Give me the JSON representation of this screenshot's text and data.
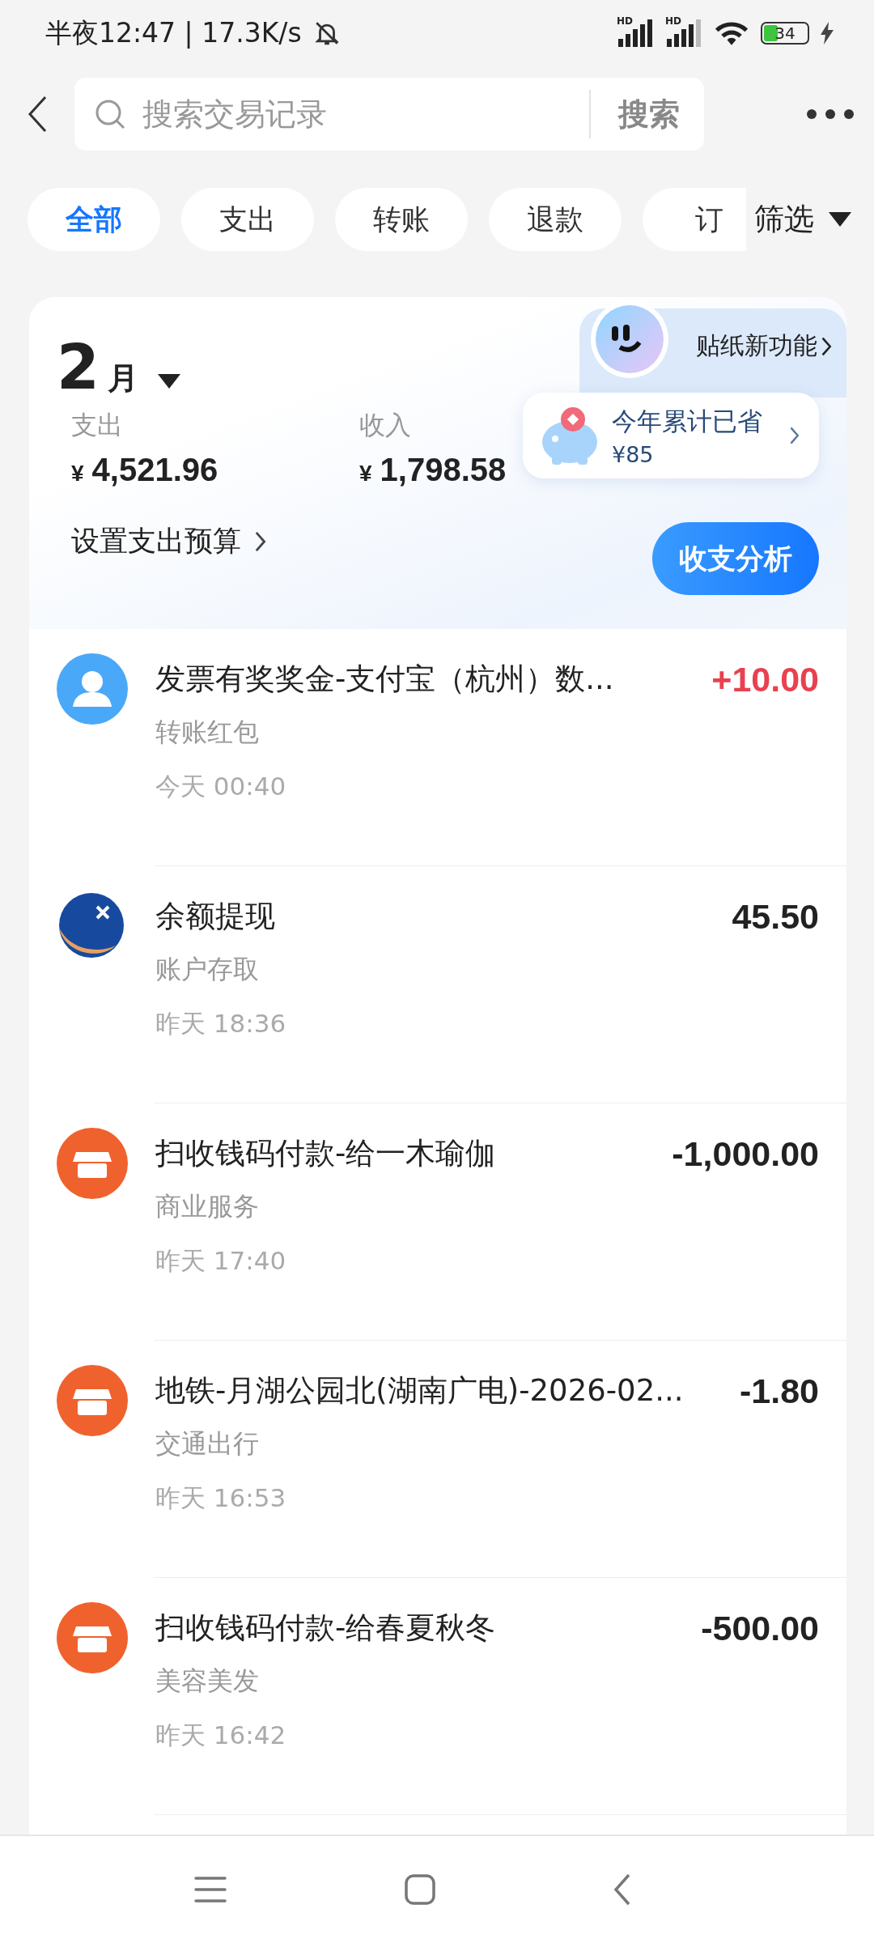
{
  "status_bar": {
    "time": "半夜12:47 | 17.3K/s",
    "signals": [
      {
        "label": "HD"
      },
      {
        "label": "HD"
      }
    ],
    "battery": "34"
  },
  "search": {
    "placeholder": "搜索交易记录",
    "button": "搜索"
  },
  "tabs": [
    {
      "label": "全部",
      "selected": true
    },
    {
      "label": "支出",
      "selected": false
    },
    {
      "label": "转账",
      "selected": false
    },
    {
      "label": "退款",
      "selected": false
    },
    {
      "label": "订",
      "selected": false
    }
  ],
  "filter": "筛选",
  "summary": {
    "month": "2",
    "month_unit": "月",
    "sticker": "贴纸新功能",
    "expense_label": "支出",
    "expense": "4,521.96",
    "income_label": "收入",
    "income": "1,798.58",
    "currency": "¥",
    "savings_label": "今年累计已省",
    "savings": "¥85",
    "budget_link": "设置支出预算",
    "analysis_button": "收支分析"
  },
  "transactions": [
    {
      "kind": "person",
      "title": "发票有奖奖金-支付宝（杭州）数...",
      "category": "转账红包",
      "time": "今天 00:40",
      "amount": "+10.00",
      "income": true
    },
    {
      "kind": "logo",
      "title": "余额提现",
      "category": "账户存取",
      "time": "昨天 18:36",
      "amount": "45.50",
      "income": false
    },
    {
      "kind": "shop",
      "title": "扫收钱码付款-给一木瑜伽",
      "category": "商业服务",
      "time": "昨天 17:40",
      "amount": "-1,000.00",
      "income": false
    },
    {
      "kind": "shop",
      "title": "地铁-月湖公园北(湖南广电)-2026-02...",
      "category": "交通出行",
      "time": "昨天 16:53",
      "amount": "-1.80",
      "income": false
    },
    {
      "kind": "shop",
      "title": "扫收钱码付款-给春夏秋冬",
      "category": "美容美发",
      "time": "昨天 16:42",
      "amount": "-500.00",
      "income": false
    }
  ]
}
